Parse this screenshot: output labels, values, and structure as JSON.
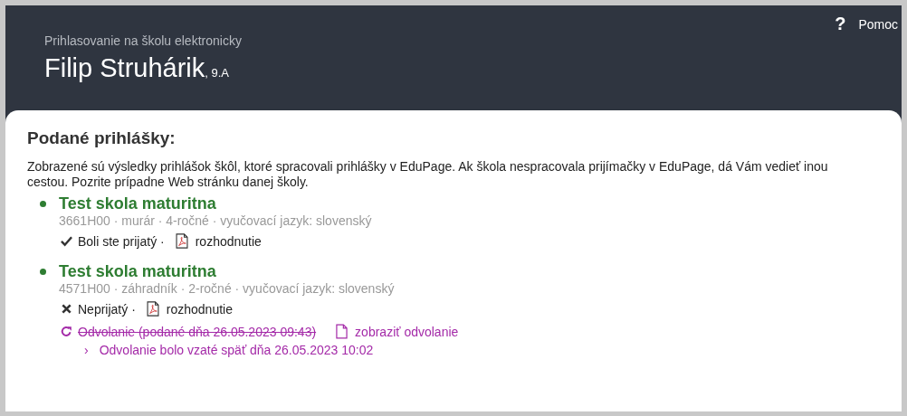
{
  "header": {
    "help": {
      "icon": "?",
      "label": "Pomoc"
    },
    "subtitle": "Prihlasovanie na školu elektronicky",
    "name": "Filip Struhárik",
    "class": ", 9.A"
  },
  "content": {
    "title": "Podané prihlášky:",
    "intro": "Zobrazené sú výsledky prihlášok škôl, ktoré spracovali prihlášky v EduPage. Ak škola nespracovala prijímačky v EduPage, dá Vám vedieť inou cestou. Pozrite prípadne Web stránku danej školy.",
    "applications": [
      {
        "school": "Test skola maturitna",
        "details": "3661H00 · murár · 4-ročné · vyučovací jazyk: slovenský",
        "result": {
          "kind": "accepted",
          "label": "Boli ste prijatý ·"
        },
        "decision": "rozhodnutie"
      },
      {
        "school": "Test skola maturitna",
        "details": "4571H00 · záhradník · 2-ročné · vyučovací jazyk: slovenský",
        "result": {
          "kind": "rejected",
          "label": "Neprijatý ·"
        },
        "decision": "rozhodnutie",
        "appeal": {
          "withdrawn": true,
          "label": "Odvolanie (podané dňa 26.05.2023 09:43)",
          "link": "zobraziť odvolanie",
          "note_marker": "›",
          "note": "Odvolanie bolo vzaté späť dňa 26.05.2023 10:02"
        }
      }
    ]
  }
}
